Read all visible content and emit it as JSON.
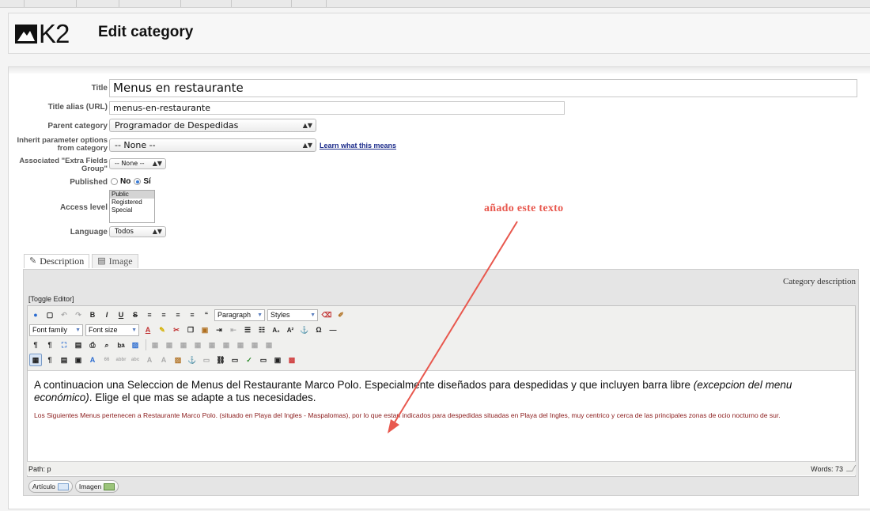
{
  "header": {
    "logo_text": "K2",
    "title": "Edit category"
  },
  "form": {
    "title_label": "Title",
    "title_value": "Menus en restaurante",
    "alias_label": "Title alias (URL)",
    "alias_value": "menus-en-restaurante",
    "parent_label": "Parent category",
    "parent_value": "Programador de Despedidas",
    "inherit_label": "Inherit parameter options from category",
    "inherit_value": "-- None --",
    "inherit_link": "Learn what this means",
    "extra_label": "Associated \"Extra Fields Group\"",
    "extra_value": "-- None --",
    "published_label": "Published",
    "published_no": "No",
    "published_yes": "Sí",
    "published_selected": "Sí",
    "access_label": "Access level",
    "access_options": [
      "Public",
      "Registered",
      "Special"
    ],
    "access_selected": "Public",
    "language_label": "Language",
    "language_value": "Todos"
  },
  "tabs": [
    {
      "label": "Description",
      "icon": "edit-icon"
    },
    {
      "label": "Image",
      "icon": "image-icon"
    }
  ],
  "editor": {
    "category_description": "Category description",
    "toggle": "[Toggle Editor]",
    "format_select": "Paragraph",
    "styles_select": "Styles",
    "font_family": "Font family",
    "font_size": "Font size",
    "content_big_1": "A continuacion una Seleccion de Menus del Restaurante Marco Polo. Especialmente diseñados para despedidas y que incluyen barra libre ",
    "content_big_italic": "(excepcion del menu económico)",
    "content_big_2": ". Elige el que mas se adapte a tus necesidades.",
    "content_small": "Los Siguientes Menus pertenecen a Restaurante Marco Polo. (situado en Playa del Ingles - Maspalomas), por lo que estan indicados para despedidas situadas en Playa del Ingles, muy centrico y cerca de las principales zonas de ocio nocturno de sur.",
    "path": "Path: p",
    "words": "Words: 73",
    "btn_articulo": "Artículo",
    "btn_imagen": "Imagen"
  },
  "annotation": {
    "text": "añado este texto",
    "color": "#e8584e"
  }
}
